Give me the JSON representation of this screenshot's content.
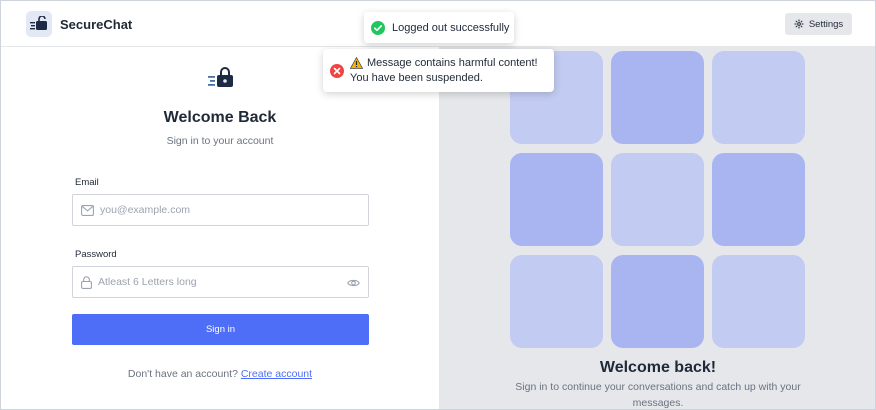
{
  "app": {
    "name": "SecureChat"
  },
  "navbar": {
    "settings_label": "Settings"
  },
  "login": {
    "title": "Welcome Back",
    "subtitle": "Sign in to your account",
    "email_label": "Email",
    "email_placeholder": "you@example.com",
    "password_label": "Password",
    "password_placeholder": "Atleast 6 Letters long",
    "submit_label": "Sign in",
    "signup_prompt": "Don't have an account?",
    "signup_link": "Create account"
  },
  "welcome_panel": {
    "title": "Welcome back!",
    "subtitle": "Sign in to continue your conversations and catch up with your messages.",
    "tile_colors": [
      "light",
      "dark",
      "light",
      "dark",
      "light",
      "dark",
      "light",
      "dark",
      "light"
    ]
  },
  "toasts": {
    "success": {
      "message": "Logged out successfully",
      "icon": "check-circle-icon"
    },
    "error": {
      "line1": "Message contains harmful content!",
      "line2": "You have been suspended.",
      "icon": "x-circle-icon",
      "warning_icon": "warning-triangle-icon"
    }
  },
  "colors": {
    "primary": "#4f6ef7",
    "tile_light": "#c2cbf1",
    "tile_dark": "#a9b5f0",
    "panel_bg": "#e5e7eb",
    "success": "#22c55e",
    "error": "#ef4444",
    "warning": "#f5b301"
  }
}
